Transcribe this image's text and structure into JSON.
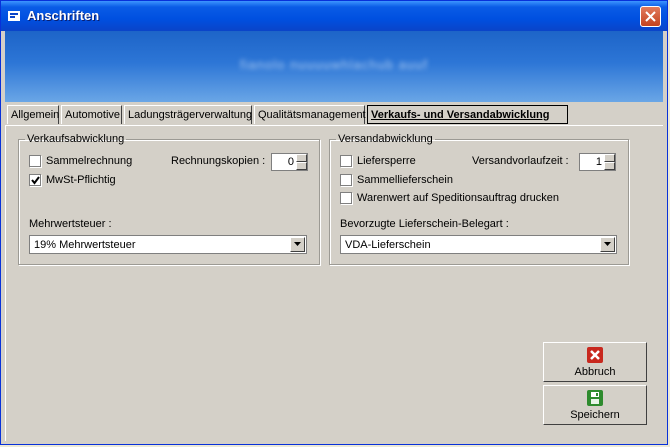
{
  "window": {
    "title": "Anschriften",
    "banner_text": "fianolo  nuuuuwhlachub auuf"
  },
  "tabs": [
    {
      "label": "Allgemein"
    },
    {
      "label": "Automotive"
    },
    {
      "label": "Ladungsträgerverwaltung"
    },
    {
      "label": "Qualitätsmanagement"
    },
    {
      "label": "Verkaufs- und Versandabwicklung"
    }
  ],
  "verkauf": {
    "legend": "Verkaufsabwicklung",
    "sammelrechnung": {
      "label": "Sammelrechnung",
      "checked": false
    },
    "mwst": {
      "label": "MwSt-Pflichtig",
      "checked": true
    },
    "rechnungskopien_label": "Rechnungskopien :",
    "rechnungskopien_value": "0",
    "mehrwertsteuer_label": "Mehrwertsteuer :",
    "mehrwertsteuer_value": "19% Mehrwertsteuer"
  },
  "versand": {
    "legend": "Versandabwicklung",
    "liefersperre": {
      "label": "Liefersperre",
      "checked": false
    },
    "sammellieferschein": {
      "label": "Sammellieferschein",
      "checked": false
    },
    "warenwert": {
      "label": "Warenwert auf Speditionsauftrag drucken",
      "checked": false
    },
    "vorlaufzeit_label": "Versandvorlaufzeit :",
    "vorlaufzeit_value": "1",
    "belegart_label": "Bevorzugte Lieferschein-Belegart :",
    "belegart_value": "VDA-Lieferschein"
  },
  "buttons": {
    "abbruch": "Abbruch",
    "speichern": "Speichern"
  },
  "colors": {
    "cancel_icon": "#c8281e",
    "save_icon": "#2e8b2e"
  }
}
